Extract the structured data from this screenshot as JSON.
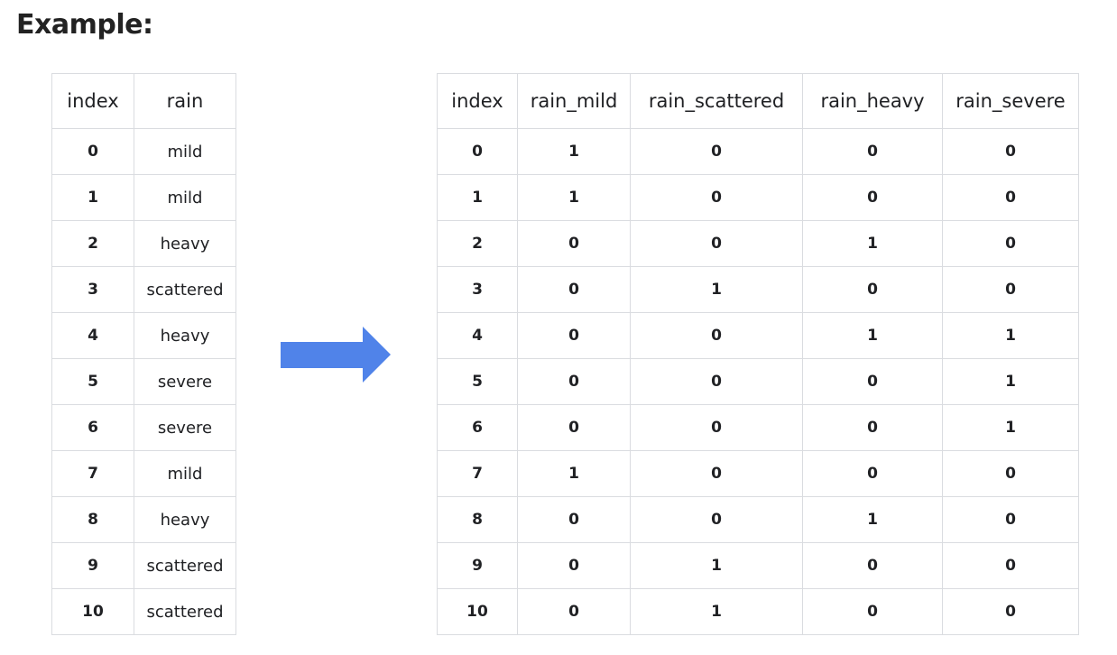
{
  "heading": "Example:",
  "left_table": {
    "columns": [
      "index",
      "rain"
    ],
    "rows": [
      [
        "0",
        "mild"
      ],
      [
        "1",
        "mild"
      ],
      [
        "2",
        "heavy"
      ],
      [
        "3",
        "scattered"
      ],
      [
        "4",
        "heavy"
      ],
      [
        "5",
        "severe"
      ],
      [
        "6",
        "severe"
      ],
      [
        "7",
        "mild"
      ],
      [
        "8",
        "heavy"
      ],
      [
        "9",
        "scattered"
      ],
      [
        "10",
        "scattered"
      ]
    ]
  },
  "right_table": {
    "columns": [
      "index",
      "rain_mild",
      "rain_scattered",
      "rain_heavy",
      "rain_severe"
    ],
    "rows": [
      [
        "0",
        "1",
        "0",
        "0",
        "0"
      ],
      [
        "1",
        "1",
        "0",
        "0",
        "0"
      ],
      [
        "2",
        "0",
        "0",
        "1",
        "0"
      ],
      [
        "3",
        "0",
        "1",
        "0",
        "0"
      ],
      [
        "4",
        "0",
        "0",
        "1",
        "1"
      ],
      [
        "5",
        "0",
        "0",
        "0",
        "1"
      ],
      [
        "6",
        "0",
        "0",
        "0",
        "1"
      ],
      [
        "7",
        "1",
        "0",
        "0",
        "0"
      ],
      [
        "8",
        "0",
        "0",
        "1",
        "0"
      ],
      [
        "9",
        "0",
        "1",
        "0",
        "0"
      ],
      [
        "10",
        "0",
        "1",
        "0",
        "0"
      ]
    ]
  },
  "arrow": {
    "icon": "right-arrow-icon",
    "color": "#5083e9"
  }
}
